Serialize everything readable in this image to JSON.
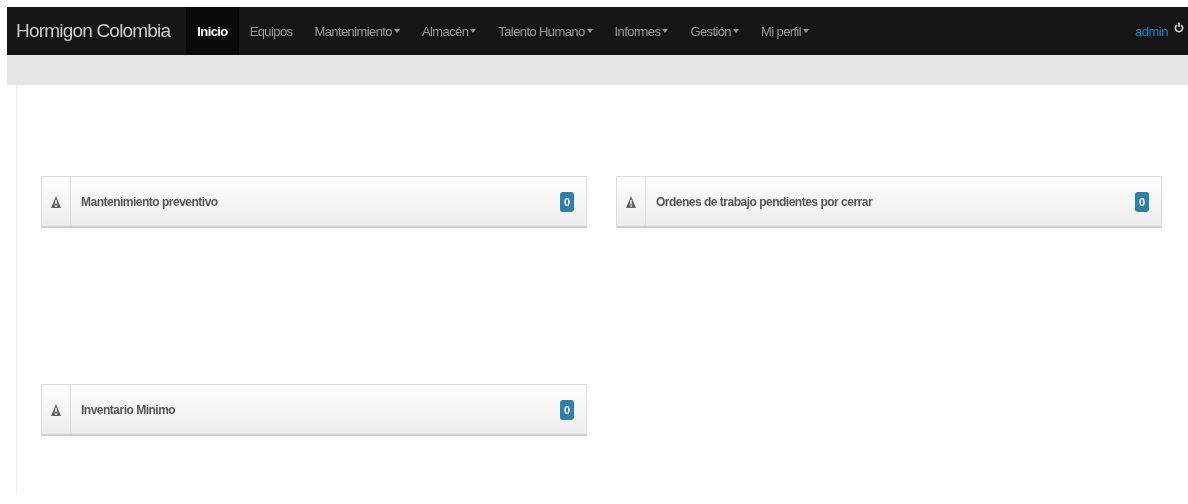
{
  "navbar": {
    "brand": "Hormigon Colombia",
    "items": [
      {
        "label": "Inicio",
        "selected": true,
        "dropdown": false
      },
      {
        "label": "Equipos",
        "selected": false,
        "dropdown": false
      },
      {
        "label": "Mantenimiento",
        "selected": false,
        "dropdown": true
      },
      {
        "label": "Almacén",
        "selected": false,
        "dropdown": true
      },
      {
        "label": "Talento Humano",
        "selected": false,
        "dropdown": true
      },
      {
        "label": "Informes",
        "selected": false,
        "dropdown": true
      },
      {
        "label": "Gestión",
        "selected": false,
        "dropdown": true
      },
      {
        "label": "Mi perfil",
        "selected": false,
        "dropdown": true
      }
    ],
    "user": "admin"
  },
  "widgets": [
    {
      "title": "Mantenimiento preventivo",
      "count": "0"
    },
    {
      "title": "Ordenes de trabajo pendientes por cerrar",
      "count": "0"
    },
    {
      "title": "Inventario Minimo",
      "count": "0"
    }
  ]
}
